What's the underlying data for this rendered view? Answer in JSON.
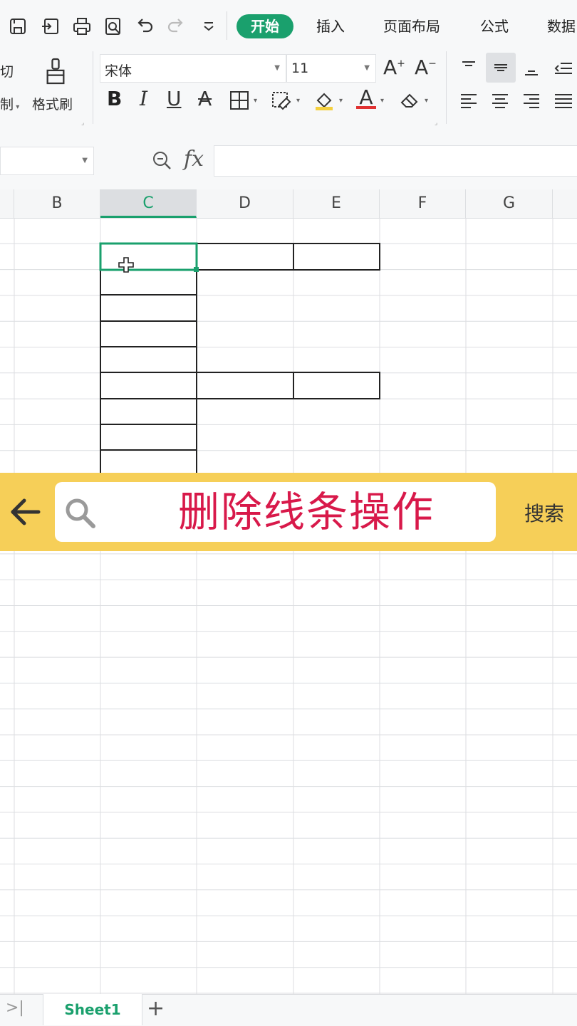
{
  "quick_access": {
    "icons": [
      "save-icon",
      "export-icon",
      "print-icon",
      "preview-icon",
      "undo-icon",
      "redo-icon",
      "more-icon"
    ]
  },
  "tabs": [
    {
      "label": "开始",
      "active": true
    },
    {
      "label": "插入",
      "active": false
    },
    {
      "label": "页面布局",
      "active": false
    },
    {
      "label": "公式",
      "active": false
    },
    {
      "label": "数据",
      "active": false
    }
  ],
  "ribbon": {
    "cut_label": "切",
    "copy_label": "制",
    "format_painter_label": "格式刷",
    "font_name": "宋体",
    "font_size": "11",
    "bold": "B",
    "italic": "I",
    "underline": "U",
    "strikethrough": "A",
    "font_color_glyph": "A",
    "increase_font": "A",
    "decrease_font": "A"
  },
  "formula_bar": {
    "fx_label": "fx",
    "value": ""
  },
  "columns": [
    {
      "label": "B",
      "selected": false
    },
    {
      "label": "C",
      "selected": true
    },
    {
      "label": "D",
      "selected": false
    },
    {
      "label": "E",
      "selected": false
    },
    {
      "label": "F",
      "selected": false
    },
    {
      "label": "G",
      "selected": false
    }
  ],
  "overlay": {
    "title": "删除线条操作",
    "search_label": "搜索"
  },
  "sheets": {
    "active": "Sheet1",
    "add_label": "+"
  },
  "colors": {
    "accent": "#1aa06d",
    "overlay_bg": "#f6cf58",
    "overlay_text": "#d8194a",
    "gridline": "#dcdee1",
    "border": "#222222"
  }
}
